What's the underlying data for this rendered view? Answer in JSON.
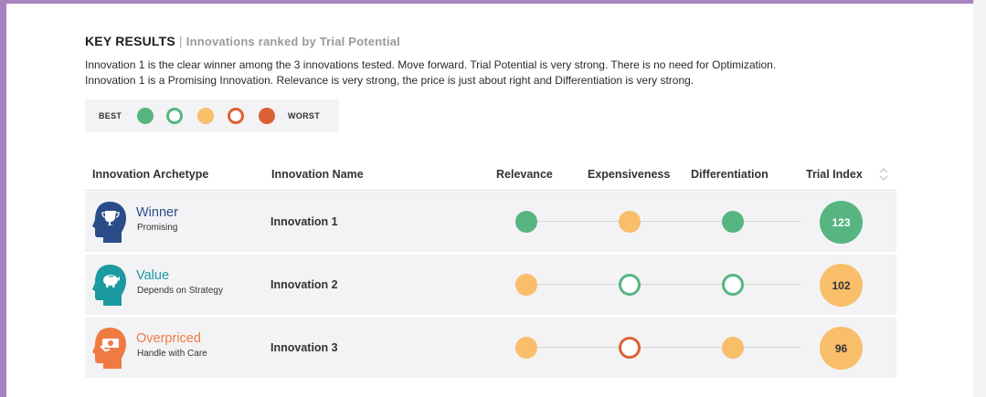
{
  "header": {
    "title": "KEY RESULTS",
    "separator": "|",
    "subtitle": "Innovations ranked by Trial Potential"
  },
  "summary": {
    "line1": "Innovation 1 is the clear winner among the 3 innovations tested. Move forward. Trial Potential is very strong. There is no need for Optimization.",
    "line2": "Innovation 1 is a Promising Innovation. Relevance is very strong, the price is just about right and Differentiation is very strong."
  },
  "legend": {
    "best_label": "BEST",
    "worst_label": "WORST",
    "scale": [
      "filled-green",
      "outline-green",
      "filled-orange",
      "outline-red",
      "filled-red"
    ]
  },
  "colors": {
    "green": "#56b580",
    "orange": "#f9be6a",
    "red": "#dd6134",
    "navy": "#2a4d8a",
    "teal": "#1b9aa0",
    "coral": "#f07a44",
    "frame": "#a781c0"
  },
  "table": {
    "columns": {
      "archetype": "Innovation Archetype",
      "name": "Innovation Name",
      "relevance": "Relevance",
      "expensiveness": "Expensiveness",
      "differentiation": "Differentiation",
      "trial_index": "Trial Index"
    },
    "rows": [
      {
        "archetype": "Winner",
        "archetype_sub": "Promising",
        "icon": "trophy-head-icon",
        "name": "Innovation 1",
        "relevance": "filled-green",
        "expensiveness": "filled-orange",
        "differentiation": "filled-green",
        "trial_index": "123",
        "trial_index_color": "green"
      },
      {
        "archetype": "Value",
        "archetype_sub": "Depends on Strategy",
        "icon": "piggy-bank-head-icon",
        "name": "Innovation 2",
        "relevance": "filled-orange",
        "expensiveness": "outline-green",
        "differentiation": "outline-green",
        "trial_index": "102",
        "trial_index_color": "orange"
      },
      {
        "archetype": "Overpriced",
        "archetype_sub": "Handle with Care",
        "icon": "money-head-icon",
        "name": "Innovation 3",
        "relevance": "filled-orange",
        "expensiveness": "outline-red",
        "differentiation": "filled-orange",
        "trial_index": "96",
        "trial_index_color": "orange"
      }
    ]
  }
}
